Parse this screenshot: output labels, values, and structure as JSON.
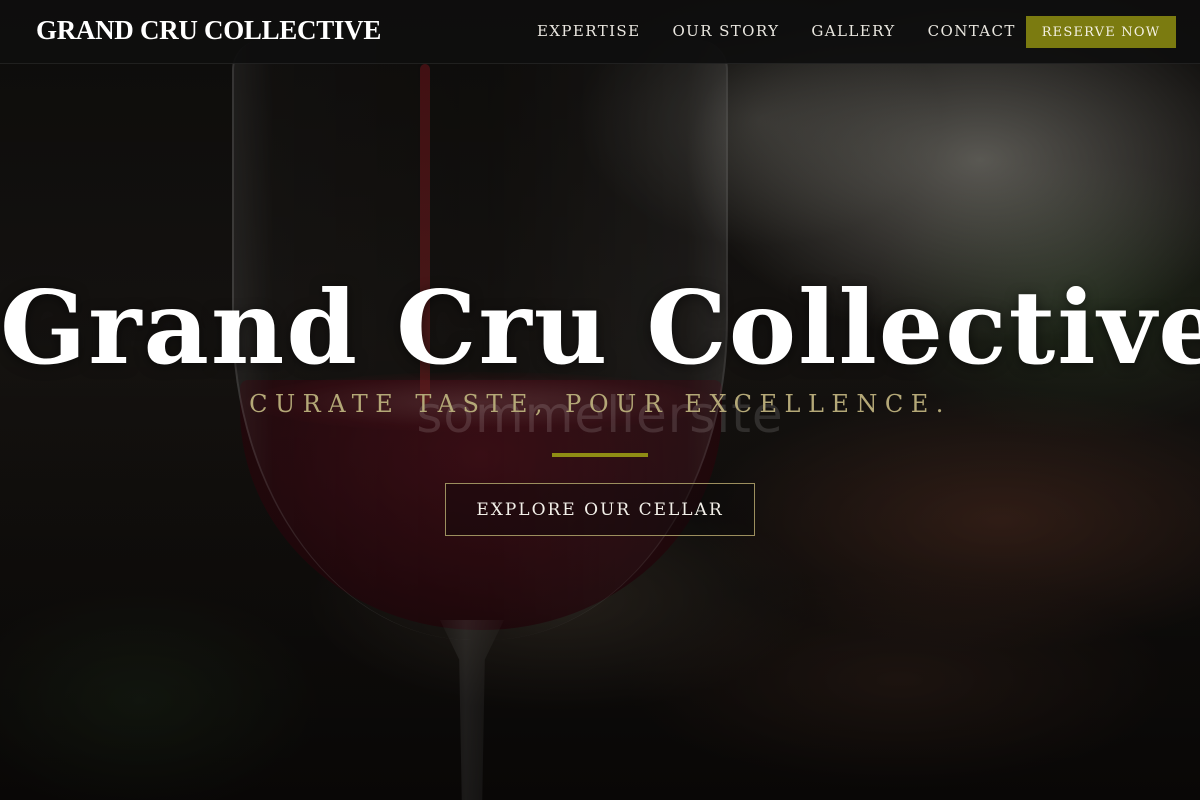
{
  "nav": {
    "brand": "GRAND CRU COLLECTIVE",
    "links": [
      "EXPERTISE",
      "OUR STORY",
      "GALLERY",
      "CONTACT"
    ],
    "cta_label": "RESERVE NOW"
  },
  "hero": {
    "title": "Grand Cru Collective",
    "tagline": "CURATE TASTE, POUR EXCELLENCE.",
    "button_label": "EXPLORE OUR CELLAR",
    "watermark": "sommeliersite"
  },
  "colors": {
    "accent": "#7b7b10",
    "tagline": "#b4a877",
    "divider": "#8f8d14",
    "nav_background": "#0e0e0e"
  }
}
